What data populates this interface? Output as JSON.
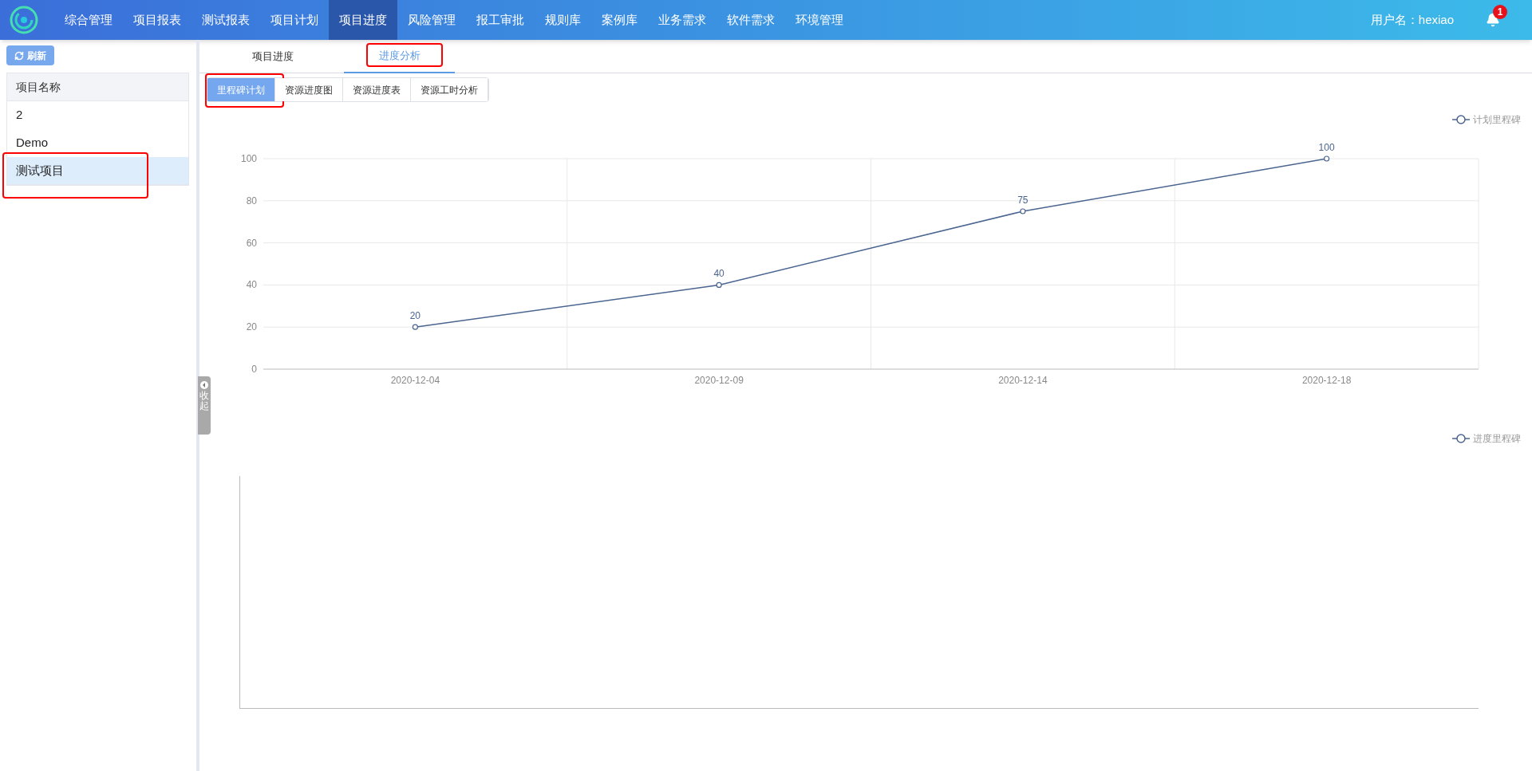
{
  "nav": {
    "items": [
      {
        "label": "综合管理",
        "selected": false
      },
      {
        "label": "项目报表",
        "selected": false
      },
      {
        "label": "测试报表",
        "selected": false
      },
      {
        "label": "项目计划",
        "selected": false
      },
      {
        "label": "项目进度",
        "selected": true
      },
      {
        "label": "风险管理",
        "selected": false
      },
      {
        "label": "报工审批",
        "selected": false
      },
      {
        "label": "规则库",
        "selected": false
      },
      {
        "label": "案例库",
        "selected": false
      },
      {
        "label": "业务需求",
        "selected": false
      },
      {
        "label": "软件需求",
        "selected": false
      },
      {
        "label": "环境管理",
        "selected": false
      }
    ],
    "user": "用户名：hexiao",
    "notifications": "1"
  },
  "sidebar": {
    "refresh": "刷新",
    "column": "项目名称",
    "projects": [
      {
        "name": "2",
        "selected": false,
        "annotated": false
      },
      {
        "name": "Demo",
        "selected": false,
        "annotated": false
      },
      {
        "name": "测试项目",
        "selected": true,
        "annotated": true
      }
    ],
    "collapse": "收起"
  },
  "tabs": [
    {
      "label": "项目进度",
      "selected": false,
      "annotated": false
    },
    {
      "label": "进度分析",
      "selected": true,
      "annotated": true
    }
  ],
  "subtabs": [
    {
      "label": "里程碑计划",
      "selected": true,
      "annotated": true
    },
    {
      "label": "资源进度图",
      "selected": false,
      "annotated": false
    },
    {
      "label": "资源进度表",
      "selected": false,
      "annotated": false
    },
    {
      "label": "资源工时分析",
      "selected": false,
      "annotated": false
    }
  ],
  "planned_chart": {
    "chart_data": {
      "type": "line",
      "categories": [
        "2020-12-04",
        "2020-12-09",
        "2020-12-14",
        "2020-12-18"
      ],
      "series": [
        {
          "name": "计划里程碑",
          "color": "#4a6590",
          "marker": "circle",
          "values": [
            20,
            40,
            75,
            100
          ]
        }
      ],
      "grid": true,
      "ylim": [
        0,
        100
      ],
      "yticks": [
        0,
        20,
        40,
        60,
        80,
        100
      ],
      "data_labels": true
    }
  },
  "progress_chart": {
    "legend": "进度里程碑"
  }
}
